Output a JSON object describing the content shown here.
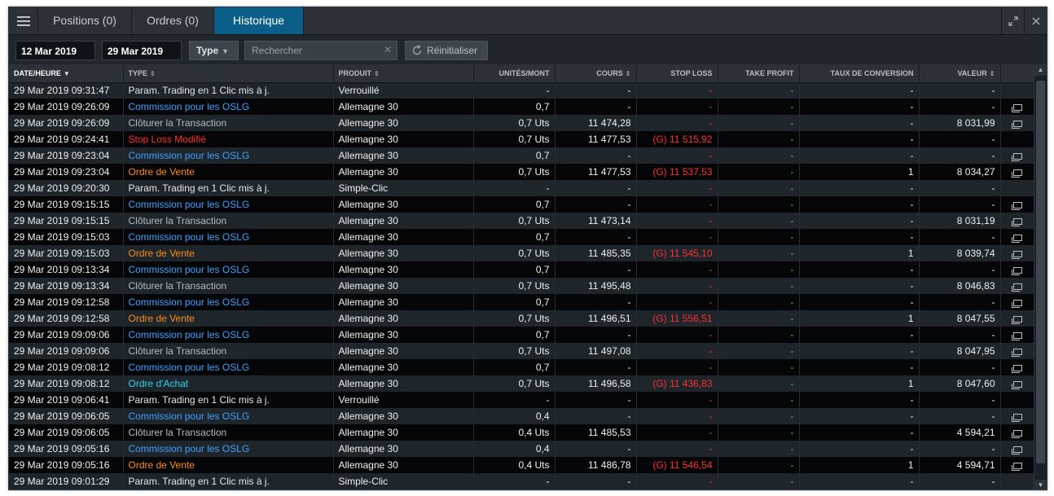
{
  "tabs": [
    {
      "label": "Positions (0)",
      "active": false
    },
    {
      "label": "Ordres (0)",
      "active": false
    },
    {
      "label": "Historique",
      "active": true
    }
  ],
  "window_controls": {
    "expand_icon": "expand-icon",
    "close_icon": "close-icon"
  },
  "filters": {
    "date_from": "12 Mar 2019",
    "date_to": "29 Mar 2019",
    "type_label": "Type",
    "search_placeholder": "Rechercher",
    "reset_label": "Réinitialiser"
  },
  "columns": [
    {
      "label": "DATE/HEURE",
      "sort": "desc-active"
    },
    {
      "label": "TYPE",
      "sort": "sortable"
    },
    {
      "label": "PRODUIT",
      "sort": "sortable"
    },
    {
      "label": "UNITÉS/MONT",
      "sort": "none"
    },
    {
      "label": "COURS",
      "sort": "sortable"
    },
    {
      "label": "STOP LOSS",
      "sort": "none"
    },
    {
      "label": "TAKE PROFIT",
      "sort": "none"
    },
    {
      "label": "TAUX DE CONVERSION",
      "sort": "none"
    },
    {
      "label": "VALEUR",
      "sort": "sortable"
    },
    {
      "label": "",
      "sort": "none"
    }
  ],
  "colors": {
    "accent_tab": "#0b5e88",
    "type_default": "#e6e6e6",
    "type_commission": "#3ea2ff",
    "type_close": "#b4bbc1",
    "type_stoploss": "#ff3030",
    "type_sell": "#ff8c1a",
    "type_buy": "#2fd6ee",
    "stop_loss": "#ff3030",
    "take_profit": "#52c84a"
  },
  "rows": [
    {
      "date": "29 Mar 2019 09:31:47",
      "type": "Param. Trading en 1 Clic mis à j.",
      "type_style": "default",
      "produit": "Verrouillé",
      "unites": "-",
      "cours": "-",
      "stop_loss": "-",
      "take_profit": "-",
      "taux": "-",
      "valeur": "-",
      "detail": false
    },
    {
      "date": "29 Mar 2019 09:26:09",
      "type": "Commission pour les OSLG",
      "type_style": "blue",
      "produit": "Allemagne 30",
      "unites": "0,7",
      "cours": "-",
      "stop_loss": "-",
      "take_profit": "-",
      "taux": "-",
      "valeur": "-",
      "detail": true
    },
    {
      "date": "29 Mar 2019 09:26:09",
      "type": "Clôturer la Transaction",
      "type_style": "gray",
      "produit": "Allemagne 30",
      "unites": "0,7 Uts",
      "cours": "11 474,28",
      "stop_loss": "-",
      "take_profit": "-",
      "taux": "-",
      "valeur": "8 031,99",
      "detail": true
    },
    {
      "date": "29 Mar 2019 09:24:41",
      "type": "Stop Loss Modifié",
      "type_style": "red",
      "produit": "Allemagne 30",
      "unites": "0,7 Uts",
      "cours": "11 477,53",
      "stop_loss": "(G) 11 515,92",
      "take_profit": "-",
      "taux": "-",
      "valeur": "-",
      "detail": false
    },
    {
      "date": "29 Mar 2019 09:23:04",
      "type": "Commission pour les OSLG",
      "type_style": "blue",
      "produit": "Allemagne 30",
      "unites": "0,7",
      "cours": "-",
      "stop_loss": "-",
      "take_profit": "-",
      "taux": "-",
      "valeur": "-",
      "detail": true
    },
    {
      "date": "29 Mar 2019 09:23:04",
      "type": "Ordre de Vente",
      "type_style": "orange",
      "produit": "Allemagne 30",
      "unites": "0,7 Uts",
      "cours": "11 477,53",
      "stop_loss": "(G) 11 537,53",
      "take_profit": "-",
      "taux": "1",
      "valeur": "8 034,27",
      "detail": true
    },
    {
      "date": "29 Mar 2019 09:20:30",
      "type": "Param. Trading en 1 Clic mis à j.",
      "type_style": "default",
      "produit": "Simple-Clic",
      "unites": "-",
      "cours": "-",
      "stop_loss": "-",
      "take_profit": "-",
      "taux": "-",
      "valeur": "-",
      "detail": false
    },
    {
      "date": "29 Mar 2019 09:15:15",
      "type": "Commission pour les OSLG",
      "type_style": "blue",
      "produit": "Allemagne 30",
      "unites": "0,7",
      "cours": "-",
      "stop_loss": "-",
      "take_profit": "-",
      "taux": "-",
      "valeur": "-",
      "detail": true
    },
    {
      "date": "29 Mar 2019 09:15:15",
      "type": "Clôturer la Transaction",
      "type_style": "gray",
      "produit": "Allemagne 30",
      "unites": "0,7 Uts",
      "cours": "11 473,14",
      "stop_loss": "-",
      "take_profit": "-",
      "taux": "-",
      "valeur": "8 031,19",
      "detail": true
    },
    {
      "date": "29 Mar 2019 09:15:03",
      "type": "Commission pour les OSLG",
      "type_style": "blue",
      "produit": "Allemagne 30",
      "unites": "0,7",
      "cours": "-",
      "stop_loss": "-",
      "take_profit": "-",
      "taux": "-",
      "valeur": "-",
      "detail": true
    },
    {
      "date": "29 Mar 2019 09:15:03",
      "type": "Ordre de Vente",
      "type_style": "orange",
      "produit": "Allemagne 30",
      "unites": "0,7 Uts",
      "cours": "11 485,35",
      "stop_loss": "(G) 11 545,10",
      "take_profit": "-",
      "taux": "1",
      "valeur": "8 039,74",
      "detail": true
    },
    {
      "date": "29 Mar 2019 09:13:34",
      "type": "Commission pour les OSLG",
      "type_style": "blue",
      "produit": "Allemagne 30",
      "unites": "0,7",
      "cours": "-",
      "stop_loss": "-",
      "take_profit": "-",
      "taux": "-",
      "valeur": "-",
      "detail": true
    },
    {
      "date": "29 Mar 2019 09:13:34",
      "type": "Clôturer la Transaction",
      "type_style": "gray",
      "produit": "Allemagne 30",
      "unites": "0,7 Uts",
      "cours": "11 495,48",
      "stop_loss": "-",
      "take_profit": "-",
      "taux": "-",
      "valeur": "8 046,83",
      "detail": true
    },
    {
      "date": "29 Mar 2019 09:12:58",
      "type": "Commission pour les OSLG",
      "type_style": "blue",
      "produit": "Allemagne 30",
      "unites": "0,7",
      "cours": "-",
      "stop_loss": "-",
      "take_profit": "-",
      "taux": "-",
      "valeur": "-",
      "detail": true
    },
    {
      "date": "29 Mar 2019 09:12:58",
      "type": "Ordre de Vente",
      "type_style": "orange",
      "produit": "Allemagne 30",
      "unites": "0,7 Uts",
      "cours": "11 496,51",
      "stop_loss": "(G) 11 556,51",
      "take_profit": "-",
      "taux": "1",
      "valeur": "8 047,55",
      "detail": true
    },
    {
      "date": "29 Mar 2019 09:09:06",
      "type": "Commission pour les OSLG",
      "type_style": "blue",
      "produit": "Allemagne 30",
      "unites": "0,7",
      "cours": "-",
      "stop_loss": "-",
      "take_profit": "-",
      "taux": "-",
      "valeur": "-",
      "detail": true
    },
    {
      "date": "29 Mar 2019 09:09:06",
      "type": "Clôturer la Transaction",
      "type_style": "gray",
      "produit": "Allemagne 30",
      "unites": "0,7 Uts",
      "cours": "11 497,08",
      "stop_loss": "-",
      "take_profit": "-",
      "taux": "-",
      "valeur": "8 047,95",
      "detail": true
    },
    {
      "date": "29 Mar 2019 09:08:12",
      "type": "Commission pour les OSLG",
      "type_style": "blue",
      "produit": "Allemagne 30",
      "unites": "0,7",
      "cours": "-",
      "stop_loss": "-",
      "take_profit": "-",
      "taux": "-",
      "valeur": "-",
      "detail": true
    },
    {
      "date": "29 Mar 2019 09:08:12",
      "type": "Ordre d'Achat",
      "type_style": "cyan",
      "produit": "Allemagne 30",
      "unites": "0,7 Uts",
      "cours": "11 496,58",
      "stop_loss": "(G) 11 436,83",
      "take_profit": "-",
      "taux": "1",
      "valeur": "8 047,60",
      "detail": true
    },
    {
      "date": "29 Mar 2019 09:06:41",
      "type": "Param. Trading en 1 Clic mis à j.",
      "type_style": "default",
      "produit": "Verrouillé",
      "unites": "-",
      "cours": "-",
      "stop_loss": "-",
      "take_profit": "-",
      "taux": "-",
      "valeur": "-",
      "detail": false
    },
    {
      "date": "29 Mar 2019 09:06:05",
      "type": "Commission pour les OSLG",
      "type_style": "blue",
      "produit": "Allemagne 30",
      "unites": "0,4",
      "cours": "-",
      "stop_loss": "-",
      "take_profit": "-",
      "taux": "-",
      "valeur": "-",
      "detail": true
    },
    {
      "date": "29 Mar 2019 09:06:05",
      "type": "Clôturer la Transaction",
      "type_style": "gray",
      "produit": "Allemagne 30",
      "unites": "0,4 Uts",
      "cours": "11 485,53",
      "stop_loss": "-",
      "take_profit": "-",
      "taux": "-",
      "valeur": "4 594,21",
      "detail": true
    },
    {
      "date": "29 Mar 2019 09:05:16",
      "type": "Commission pour les OSLG",
      "type_style": "blue",
      "produit": "Allemagne 30",
      "unites": "0,4",
      "cours": "-",
      "stop_loss": "-",
      "take_profit": "-",
      "taux": "-",
      "valeur": "-",
      "detail": true
    },
    {
      "date": "29 Mar 2019 09:05:16",
      "type": "Ordre de Vente",
      "type_style": "orange",
      "produit": "Allemagne 30",
      "unites": "0,4 Uts",
      "cours": "11 486,78",
      "stop_loss": "(G) 11 546,54",
      "take_profit": "-",
      "taux": "1",
      "valeur": "4 594,71",
      "detail": true
    },
    {
      "date": "29 Mar 2019 09:01:29",
      "type": "Param. Trading en 1 Clic mis à j.",
      "type_style": "default",
      "produit": "Simple-Clic",
      "unites": "-",
      "cours": "-",
      "stop_loss": "-",
      "take_profit": "-",
      "taux": "-",
      "valeur": "-",
      "detail": false
    }
  ]
}
